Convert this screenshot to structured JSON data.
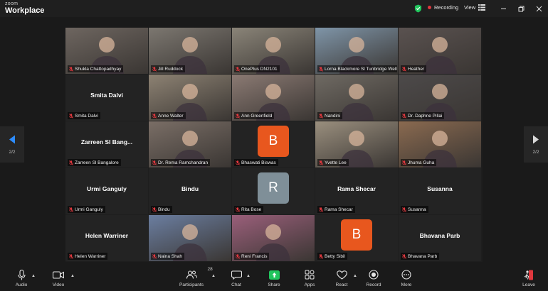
{
  "app": {
    "brand_small": "zoom",
    "brand_large": "Workplace",
    "recording_label": "Recording",
    "view_label": "View"
  },
  "pager": {
    "left_label": "2/2",
    "right_label": "2/2"
  },
  "participants": [
    {
      "name": "Shukla Chattopadhyay",
      "type": "video",
      "bg": "#6e6660"
    },
    {
      "name": "Jill Ruddock",
      "type": "video",
      "bg": "#7c7770"
    },
    {
      "name": "OnePlus DN2101",
      "type": "video",
      "bg": "#8a8478"
    },
    {
      "name": "Lorna Blackmore Sl Tunbridge Wells",
      "type": "video",
      "bg": "#7f95a8"
    },
    {
      "name": "Heather",
      "type": "video",
      "bg": "#5a5250"
    },
    {
      "name": "Smita Dalvi",
      "type": "name",
      "display": "Smita Dalvi"
    },
    {
      "name": "Anne Walter",
      "type": "video",
      "bg": "#8d8273"
    },
    {
      "name": "Ann Greenfield",
      "type": "video",
      "bg": "#8b7a73"
    },
    {
      "name": "Nandini",
      "type": "video",
      "bg": "#6f6a63"
    },
    {
      "name": "Dr. Daphne Pillai",
      "type": "video",
      "bg": "#4d4a4a"
    },
    {
      "name": "Zarreen Sl Bangalore",
      "type": "name",
      "display": "Zarreen SI Bang..."
    },
    {
      "name": "Dr. Rema Ramchandran",
      "type": "video",
      "bg": "#7a6e66"
    },
    {
      "name": "Bhaswati Biswas",
      "type": "avatar",
      "initial": "B",
      "color": "#e8571e"
    },
    {
      "name": "Yvette Lee",
      "type": "video",
      "bg": "#9a8f7e"
    },
    {
      "name": "Jhuma Guha",
      "type": "video",
      "bg": "#8a6a50"
    },
    {
      "name": "Urmi Ganguly",
      "type": "name",
      "display": "Urmi Ganguly"
    },
    {
      "name": "Bindu",
      "type": "name",
      "display": "Bindu"
    },
    {
      "name": "Rita Bose",
      "type": "avatar",
      "initial": "R",
      "color": "#7f8f98"
    },
    {
      "name": "Rama Shecar",
      "type": "name",
      "display": "Rama Shecar"
    },
    {
      "name": "Susanna",
      "type": "name",
      "display": "Susanna"
    },
    {
      "name": "Helen Warriner",
      "type": "name",
      "display": "Helen Warriner"
    },
    {
      "name": "Naina Shah",
      "type": "video",
      "bg": "#6b7ea0"
    },
    {
      "name": "Reni Francis",
      "type": "video",
      "bg": "#9a5f7a"
    },
    {
      "name": "Betty Sibil",
      "type": "avatar",
      "initial": "B",
      "color": "#e8571e"
    },
    {
      "name": "Bhavana Parb",
      "type": "name",
      "display": "Bhavana Parb"
    }
  ],
  "toolbar": {
    "audio": "Audio",
    "video": "Video",
    "participants": "Participants",
    "participants_count": "28",
    "chat": "Chat",
    "share": "Share",
    "apps": "Apps",
    "react": "React",
    "record": "Record",
    "more": "More",
    "leave": "Leave"
  },
  "colors": {
    "share_green": "#21c55d",
    "leave_red": "#e0383e",
    "muted_red": "#e0383e",
    "arrow_blue": "#2d8cff"
  }
}
